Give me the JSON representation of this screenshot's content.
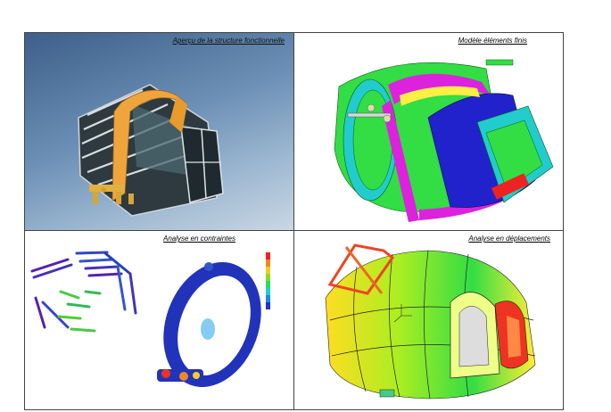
{
  "panels": [
    {
      "caption": "Aperçu de la structure fonctionnelle"
    },
    {
      "caption": "Modèle éléments finis"
    },
    {
      "caption": "Analyse en contraintes"
    },
    {
      "caption": "Analyse en déplacements"
    }
  ],
  "colors": {
    "border": "#444444",
    "render_bg_top": "#3d5f8a",
    "render_bg_bottom": "#c9d7e4",
    "orange_ring": "#f0a53c",
    "fem_green": "#33dd44",
    "fem_blue": "#2222cc",
    "fem_magenta": "#dd22dd",
    "fem_cyan": "#22cccc",
    "fem_red": "#ee2222",
    "stress_ring": "#2233bb"
  }
}
